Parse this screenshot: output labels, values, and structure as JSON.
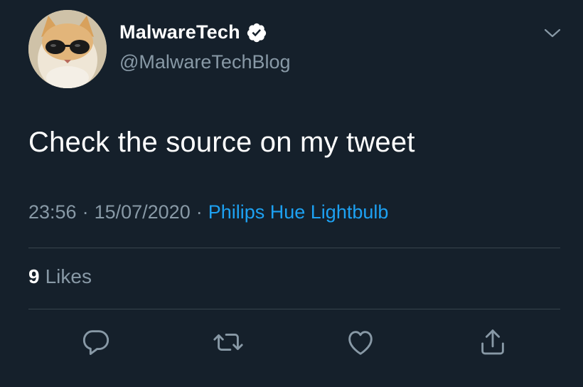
{
  "user": {
    "display_name": "MalwareTech",
    "handle": "@MalwareTechBlog",
    "verified": true,
    "avatar": "cat-with-sunglasses-avatar"
  },
  "tweet": {
    "text": "Check the source on my tweet",
    "time": "23:56",
    "date": "15/07/2020",
    "separator": "·",
    "source": "Philips Hue Lightbulb"
  },
  "stats": {
    "likes_count": "9",
    "likes_label": "Likes"
  },
  "actions": [
    {
      "name": "reply",
      "icon": "reply-icon"
    },
    {
      "name": "retweet",
      "icon": "retweet-icon"
    },
    {
      "name": "like",
      "icon": "heart-icon"
    },
    {
      "name": "share",
      "icon": "share-icon"
    }
  ],
  "colors": {
    "background": "#15202b",
    "text_primary": "#ffffff",
    "text_secondary": "#8899a6",
    "link": "#1da1f2",
    "divider": "#38444d"
  }
}
